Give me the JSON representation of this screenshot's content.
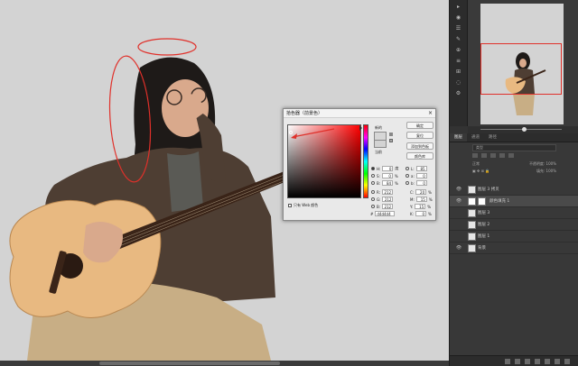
{
  "color_picker": {
    "title": "拾色器（前景色）",
    "close_glyph": "×",
    "new_label": "新的",
    "current_label": "当前",
    "buttons": {
      "ok": "确定",
      "reset": "复位",
      "add_to_swatches": "添加到色板",
      "color_libraries": "颜色库"
    },
    "fields_left": [
      {
        "label": "H:",
        "value": "0",
        "unit": "度",
        "selected": true
      },
      {
        "label": "S:",
        "value": "0",
        "unit": "%"
      },
      {
        "label": "B:",
        "value": "84",
        "unit": "%"
      },
      {
        "label": "R:",
        "value": "212",
        "unit": ""
      },
      {
        "label": "G:",
        "value": "212",
        "unit": ""
      },
      {
        "label": "B:",
        "value": "212",
        "unit": ""
      }
    ],
    "fields_right": [
      {
        "label": "L:",
        "value": "85",
        "unit": ""
      },
      {
        "label": "a:",
        "value": "0",
        "unit": ""
      },
      {
        "label": "b:",
        "value": "0",
        "unit": ""
      },
      {
        "label": "C:",
        "value": "20",
        "unit": "%"
      },
      {
        "label": "M:",
        "value": "15",
        "unit": "%"
      },
      {
        "label": "Y:",
        "value": "15",
        "unit": "%"
      },
      {
        "label": "K:",
        "value": "0",
        "unit": "%"
      }
    ],
    "web_colors_label": "只有 Web 颜色",
    "hex_label": "#",
    "hex_value": "d4d4d4",
    "new_color": "#d6d6d6",
    "current_color": "#d3d3d3"
  },
  "layers_panel": {
    "tabs": [
      "图层",
      "通道",
      "路径"
    ],
    "filter_label": "类型",
    "mode_label": "正常",
    "opacity_label": "不透明度: 100%",
    "fill_label": "填充: 100%",
    "layers": [
      {
        "name": "图层 3 拷贝",
        "visible": true,
        "selected": false,
        "has_mask": false
      },
      {
        "name": "颜色填充 1",
        "visible": true,
        "selected": true,
        "has_mask": true
      },
      {
        "name": "图层 3",
        "visible": false,
        "selected": false,
        "has_mask": false
      },
      {
        "name": "图层 2",
        "visible": false,
        "selected": false,
        "has_mask": false
      },
      {
        "name": "图层 1",
        "visible": false,
        "selected": false,
        "has_mask": false
      },
      {
        "name": "背景",
        "visible": true,
        "selected": false,
        "has_mask": false
      }
    ]
  },
  "icons": {
    "eye": "👁",
    "tool_glyphs": [
      "▸",
      "◉",
      "☰",
      "✎",
      "⊕",
      "≡",
      "⊞",
      "◌",
      "⚙"
    ]
  },
  "colors": {
    "canvas_bg": "#d3d3d3",
    "annotation_red": "#e0302a",
    "panel_bg": "#383838"
  }
}
